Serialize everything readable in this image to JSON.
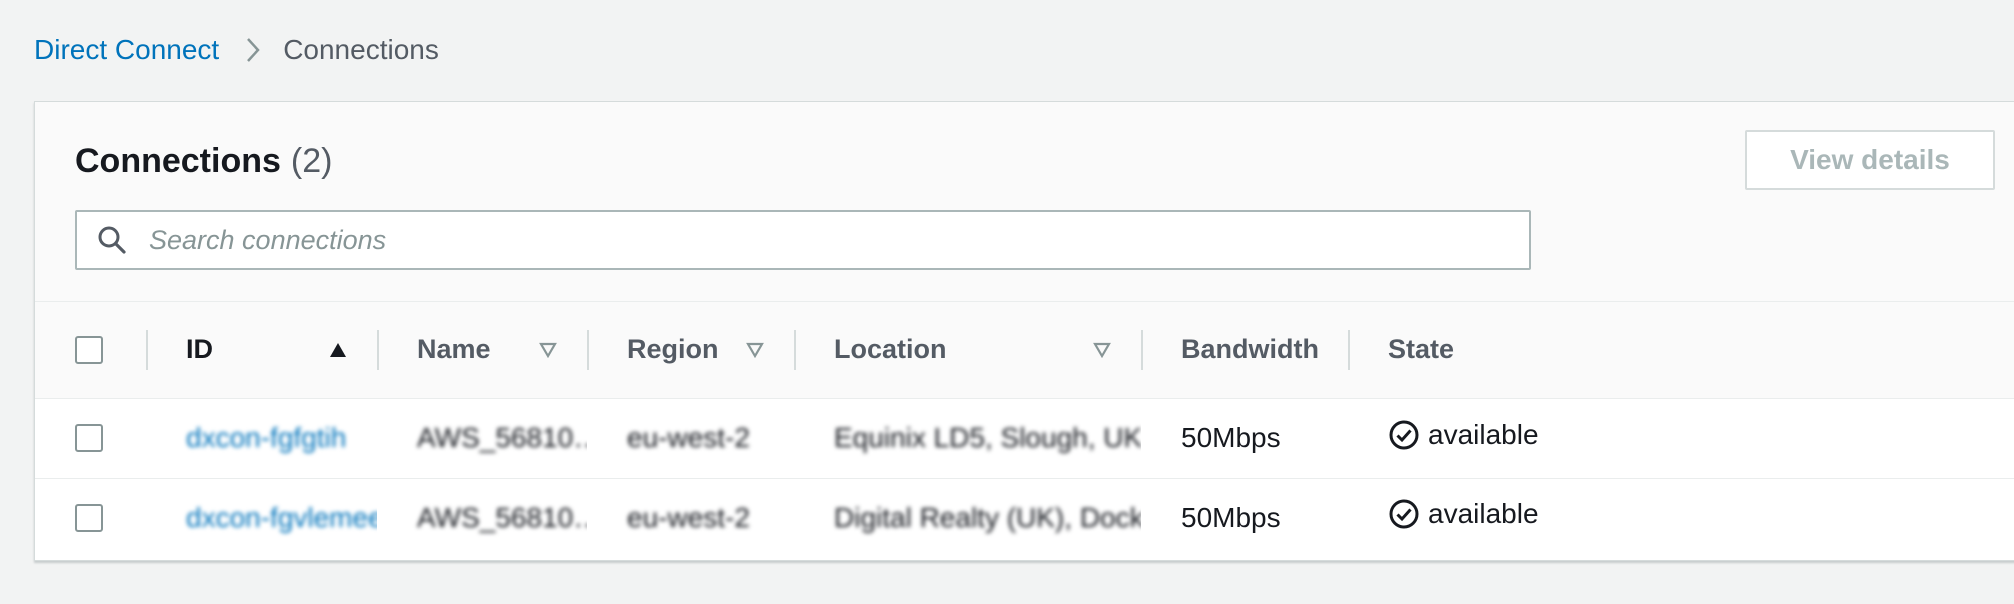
{
  "breadcrumb": {
    "parent": "Direct Connect",
    "current": "Connections"
  },
  "panel": {
    "title": "Connections",
    "count": "(2)",
    "view_details_label": "View details",
    "search_placeholder": "Search connections"
  },
  "table": {
    "headers": {
      "id": "ID",
      "name": "Name",
      "region": "Region",
      "location": "Location",
      "bandwidth": "Bandwidth",
      "state": "State"
    },
    "rows": [
      {
        "id": "dxcon-fgfgtih",
        "name": "AWS_56810…",
        "region": "eu-west-2",
        "location": "Equinix LD5, Slough, UK",
        "bandwidth": "50Mbps",
        "state": "available"
      },
      {
        "id": "dxcon-fgvlemee",
        "name": "AWS_56810…",
        "region": "eu-west-2",
        "location": "Digital Realty (UK), Docklands",
        "bandwidth": "50Mbps",
        "state": "available"
      }
    ]
  },
  "colors": {
    "link": "#0073bb",
    "text": "#16191f",
    "muted": "#545b64",
    "border": "#d5dbdb"
  }
}
